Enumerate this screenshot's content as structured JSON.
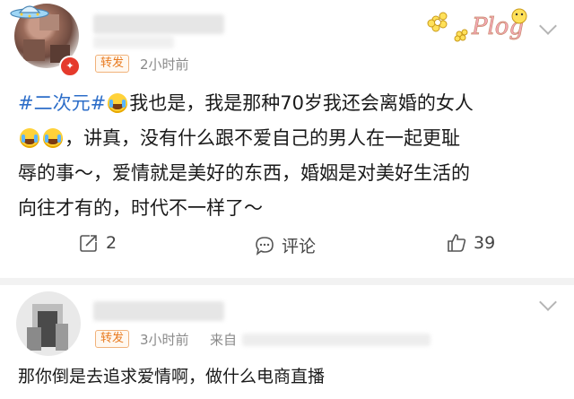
{
  "post1": {
    "tag": "转发",
    "time": "2小时前",
    "topic": "#二次元#",
    "text_line1": "我也是，我是那种70岁我还会离婚的女人",
    "text_line2": "，讲真，没有什么跟不爱自己的男人在一起更耻",
    "text_line3": "辱的事～，爱情就是美好的东西，婚姻是对美好生活的",
    "text_line4": "向往才有的，时代不一样了～",
    "sticker_text": "Plog",
    "actions": {
      "repost_count": "2",
      "comment_label": "评论",
      "like_count": "39"
    }
  },
  "post2": {
    "tag": "转发",
    "time": "3小时前",
    "source_prefix": "来自",
    "text": "那你倒是去追求爱情啊，做什么电商直播"
  },
  "colors": {
    "topic": "#2d6ec9",
    "tag": "#e87a1f",
    "meta": "#8a8a8a",
    "verified": "#e53a2c"
  }
}
